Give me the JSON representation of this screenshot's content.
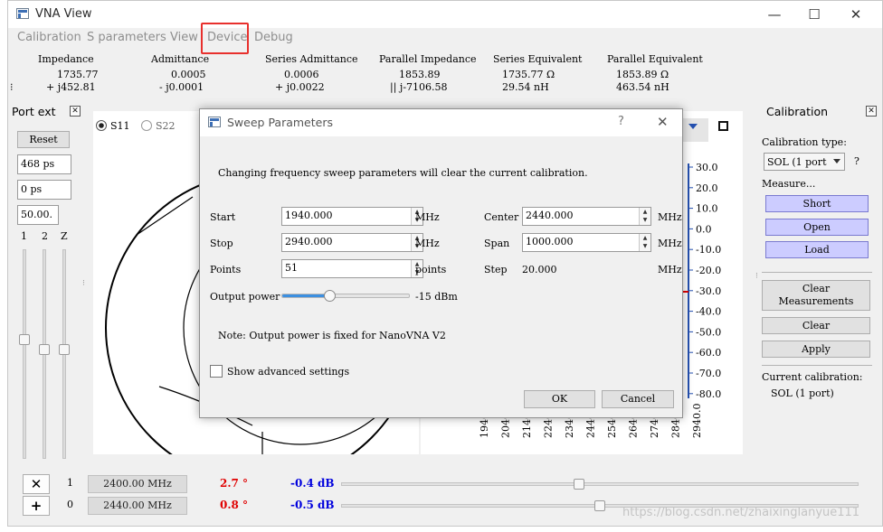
{
  "window": {
    "title": "VNA View",
    "minimize": "—",
    "maximize": "☐",
    "close": "✕"
  },
  "menu": [
    "Calibration",
    "S parameters",
    "View",
    "Device",
    "Debug"
  ],
  "readout": {
    "headers": [
      "Impedance",
      "Admittance",
      "Series Admittance",
      "Parallel Impedance",
      "Series Equivalent",
      "Parallel Equivalent"
    ],
    "row1": [
      "1735.77",
      "0.0005",
      "0.0006",
      "1853.89",
      "1735.77 Ω",
      "1853.89 Ω"
    ],
    "row2": [
      "+ j452.81",
      "- j0.0001",
      "+ j0.0022",
      "|| j-7106.58",
      "29.54 nH",
      "463.54 nH"
    ]
  },
  "port_ext": {
    "title": "Port ext",
    "reset": "Reset",
    "fields": [
      "468 ps",
      "0 ps",
      "50.00."
    ],
    "slider_labels": [
      "1",
      "2",
      "Z"
    ],
    "slider_levels": [
      0.55,
      0.5,
      0.5
    ]
  },
  "smith": {
    "radio_s11": "S11",
    "radio_s22": "S22",
    "s11_checked": true
  },
  "right_plot": {
    "y_ticks": [
      "30.0",
      "20.0",
      "10.0",
      "0.0",
      "-10.0",
      "-20.0",
      "-30.0",
      "-40.0",
      "-50.0",
      "-60.0",
      "-70.0",
      "-80.0"
    ],
    "x_ticks": [
      "1940",
      "2040",
      "2140",
      "2240",
      "2340",
      "2440",
      "2540",
      "2640",
      "2740",
      "2840",
      "2940.0"
    ]
  },
  "calibration": {
    "title": "Calibration",
    "type_label": "Calibration type:",
    "type_value": "SOL (1 port",
    "help": "?",
    "measure_label": "Measure...",
    "short": "Short",
    "open": "Open",
    "load": "Load",
    "clear_measurements_1": "Clear",
    "clear_measurements_2": "Measurements",
    "clear": "Clear",
    "apply": "Apply",
    "current_label": "Current calibration:",
    "current_value": "SOL (1 port)"
  },
  "markers": [
    {
      "button": "✕",
      "index": "1",
      "freq": "2400.00 MHz",
      "phase": "2.7 °",
      "mag": "-0.4 dB",
      "pos": 0.46
    },
    {
      "button": "+",
      "index": "0",
      "freq": "2440.00 MHz",
      "phase": "0.8 °",
      "mag": "-0.5 dB",
      "pos": 0.5
    }
  ],
  "watermark": "https://blog.csdn.net/zhaixinglanyue111",
  "dialog": {
    "title": "Sweep Parameters",
    "help": "?",
    "close": "✕",
    "warning": "Changing frequency sweep parameters will clear the current calibration.",
    "start_label": "Start",
    "start_value": "1940.000",
    "start_unit": "MHz",
    "stop_label": "Stop",
    "stop_value": "2940.000",
    "stop_unit": "MHz",
    "points_label": "Points",
    "points_value": "51",
    "points_unit": "points",
    "center_label": "Center",
    "center_value": "2440.000",
    "center_unit": "MHz",
    "span_label": "Span",
    "span_value": "1000.000",
    "span_unit": "MHz",
    "step_label": "Step",
    "step_value": "20.000",
    "step_unit": "MHz",
    "power_label": "Output power",
    "power_value": "-15 dBm",
    "power_level": 0.38,
    "note": "Note: Output power is fixed for NanoVNA V2",
    "advanced": "Show advanced settings",
    "ok": "OK",
    "cancel": "Cancel"
  }
}
